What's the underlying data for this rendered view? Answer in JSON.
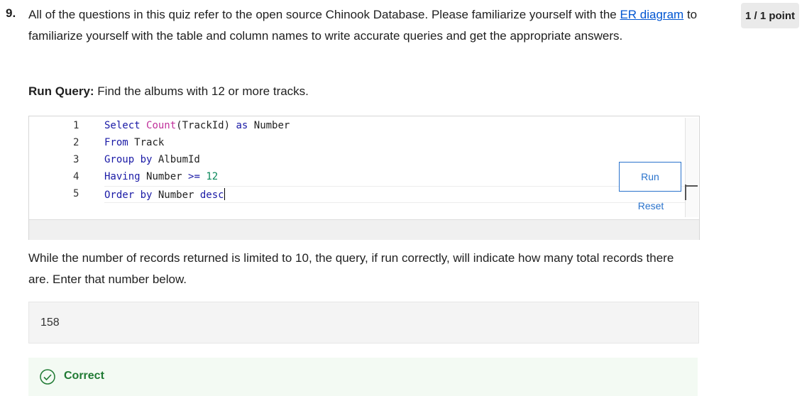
{
  "question": {
    "number": "9.",
    "points": "1 / 1 point",
    "prompt_before_link": "All of the questions in this quiz refer to the open source Chinook Database. Please familiarize yourself with the ",
    "link_text": "ER diagram",
    "prompt_after_link": " to familiarize yourself with the table and column names to write accurate queries and get the appropriate answers.",
    "run_query_label": "Run Query:",
    "run_query_text": " Find the albums with 12 or more tracks."
  },
  "editor": {
    "line_numbers": [
      "1",
      "2",
      "3",
      "4",
      "5"
    ],
    "lines": [
      [
        {
          "t": "Select ",
          "c": "kw"
        },
        {
          "t": "Count",
          "c": "fn"
        },
        {
          "t": "(TrackId) ",
          "c": ""
        },
        {
          "t": "as ",
          "c": "kw"
        },
        {
          "t": "Number",
          "c": ""
        }
      ],
      [
        {
          "t": "From ",
          "c": "kw"
        },
        {
          "t": "Track",
          "c": ""
        }
      ],
      [
        {
          "t": "Group by ",
          "c": "kw"
        },
        {
          "t": "AlbumId",
          "c": ""
        }
      ],
      [
        {
          "t": "Having ",
          "c": "kw"
        },
        {
          "t": "Number ",
          "c": ""
        },
        {
          "t": ">= ",
          "c": "op"
        },
        {
          "t": "12",
          "c": "num"
        }
      ],
      [
        {
          "t": "Order by ",
          "c": "kw"
        },
        {
          "t": "Number ",
          "c": ""
        },
        {
          "t": "desc",
          "c": "kw"
        }
      ]
    ],
    "run_label": "Run",
    "reset_label": "Reset"
  },
  "description": "While the number of records returned is limited to 10, the query, if run correctly, will indicate how many total records there are. Enter that number below.",
  "answer": {
    "value": "158"
  },
  "feedback": {
    "label": "Correct",
    "status_color": "#1f7a33"
  }
}
